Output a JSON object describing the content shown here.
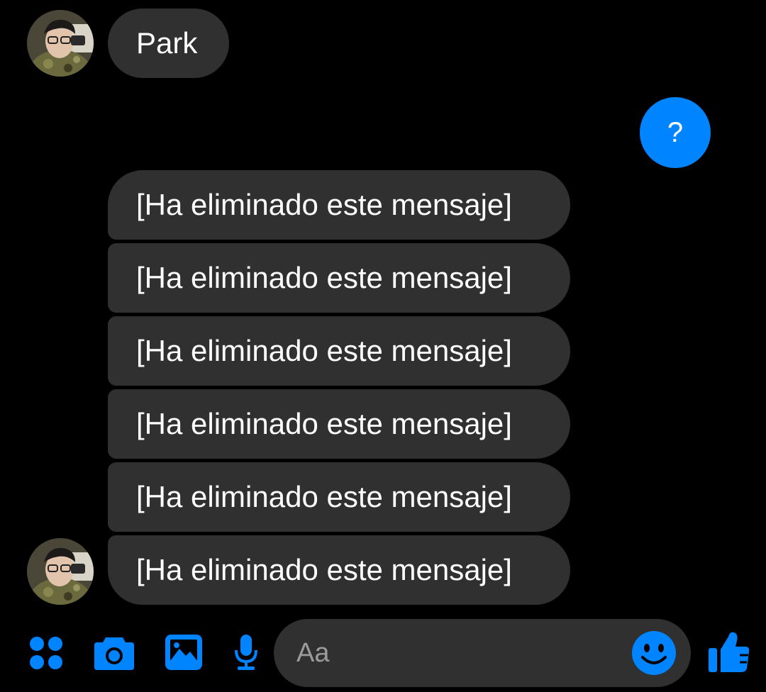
{
  "accent_color": "#0084ff",
  "received_bubble_color": "#303030",
  "contact": {
    "name_message": "Park",
    "avatar": "profile-photo"
  },
  "sent": {
    "text": "?"
  },
  "received_messages": [
    {
      "text": "[Ha eliminado este mensaje]"
    },
    {
      "text": "[Ha eliminado este mensaje]"
    },
    {
      "text": "[Ha eliminado este mensaje]"
    },
    {
      "text": "[Ha eliminado este mensaje]"
    },
    {
      "text": "[Ha eliminado este mensaje]"
    },
    {
      "text": "[Ha eliminado este mensaje]"
    }
  ],
  "composer": {
    "placeholder": "Aa",
    "icons": [
      "apps-grid-icon",
      "camera-icon",
      "gallery-icon",
      "microphone-icon",
      "emoji-icon",
      "thumbs-up-icon"
    ]
  }
}
